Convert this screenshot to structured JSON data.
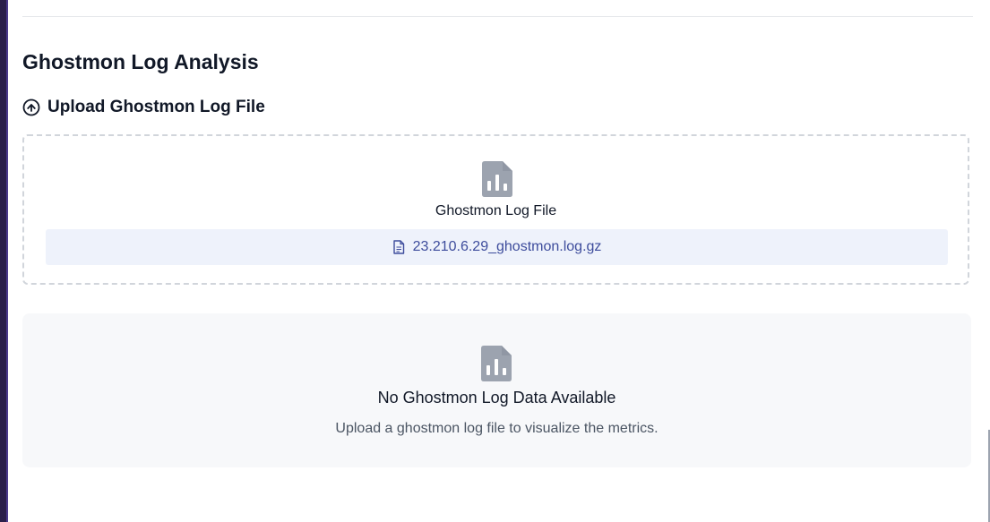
{
  "page": {
    "title": "Ghostmon Log Analysis"
  },
  "upload_section": {
    "title": "Upload Ghostmon Log File",
    "icon": "cloud-upload-icon",
    "dropzone": {
      "label": "Ghostmon Log File",
      "icon": "document-chart-icon",
      "selected_file": "23.210.6.29_ghostmon.log.gz",
      "file_icon": "document-icon"
    }
  },
  "empty_state": {
    "icon": "document-chart-icon",
    "title": "No Ghostmon Log Data Available",
    "description": "Upload a ghostmon log file to visualize the metrics."
  },
  "colors": {
    "icon_gray": "#9ca3af",
    "file_chip_bg": "#eef2fb",
    "file_chip_text": "#3d4c9c",
    "card_bg": "#f7f8fa"
  }
}
